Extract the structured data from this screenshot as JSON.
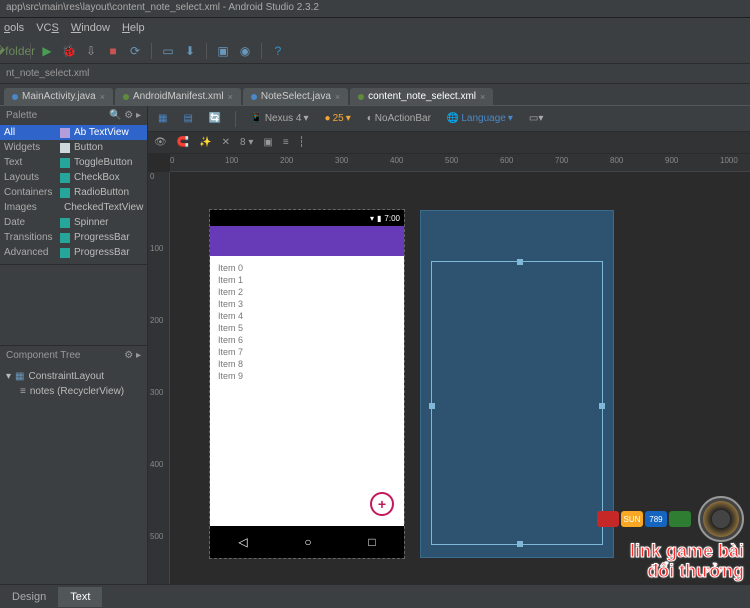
{
  "title_bar": "app\\src\\main\\res\\layout\\content_note_select.xml - Android Studio 2.3.2",
  "menu": {
    "items": [
      "ols",
      "VCS",
      "Window",
      "Help"
    ],
    "underlines": [
      "o",
      "S",
      "W",
      "H"
    ]
  },
  "crumb": "nt_note_select.xml",
  "tabs": [
    {
      "label": "MainActivity.java",
      "icon": "java",
      "active": false
    },
    {
      "label": "AndroidManifest.xml",
      "icon": "xml",
      "active": false
    },
    {
      "label": "NoteSelect.java",
      "icon": "java",
      "active": false
    },
    {
      "label": "content_note_select.xml",
      "icon": "xml",
      "active": true
    }
  ],
  "palette": {
    "title": "Palette",
    "cats": [
      "All",
      "Widgets",
      "Text",
      "Layouts",
      "Containers",
      "Images",
      "Date",
      "Transitions",
      "Advanced"
    ],
    "widgets": [
      {
        "l": "TextView",
        "sel": true,
        "c": "#b39ddb"
      },
      {
        "l": "Button",
        "sel": false,
        "c": "#cfd8dc"
      },
      {
        "l": "ToggleButton",
        "sel": false,
        "c": "#26a69a"
      },
      {
        "l": "CheckBox",
        "sel": false,
        "c": "#26a69a"
      },
      {
        "l": "RadioButton",
        "sel": false,
        "c": "#26a69a"
      },
      {
        "l": "CheckedTextView",
        "sel": false,
        "c": "#26a69a"
      },
      {
        "l": "Spinner",
        "sel": false,
        "c": "#26a69a"
      },
      {
        "l": "ProgressBar",
        "sel": false,
        "c": "#26a69a"
      },
      {
        "l": "ProgressBar",
        "sel": false,
        "c": "#26a69a"
      }
    ]
  },
  "tree": {
    "title": "Component Tree",
    "root": "ConstraintLayout",
    "child": "notes (RecyclerView)"
  },
  "design_toolbar": {
    "device": "Nexus 4",
    "api": "25",
    "theme": "NoActionBar",
    "lang": "Language"
  },
  "design_toolbar2": {
    "pct": "8"
  },
  "ruler_h": [
    "0",
    "100",
    "200",
    "300",
    "400",
    "500",
    "600",
    "700",
    "800",
    "900",
    "1000"
  ],
  "ruler_v": [
    "0",
    "100",
    "200",
    "300",
    "400",
    "500"
  ],
  "device_preview": {
    "time": "7:00",
    "items": [
      "Item 0",
      "Item 1",
      "Item 2",
      "Item 3",
      "Item 4",
      "Item 5",
      "Item 6",
      "Item 7",
      "Item 8",
      "Item 9"
    ],
    "nav": [
      "◁",
      "○",
      "□"
    ]
  },
  "bottom_tabs": {
    "design": "Design",
    "text": "Text"
  },
  "watermark": {
    "line1": "link game bài",
    "line2": "đổi thưởng",
    "chips": [
      {
        "t": "",
        "c": "#c62828"
      },
      {
        "t": "SUN",
        "c": "#f9a825"
      },
      {
        "t": "789",
        "c": "#1565c0"
      },
      {
        "t": "",
        "c": "#2e7d32"
      }
    ]
  }
}
